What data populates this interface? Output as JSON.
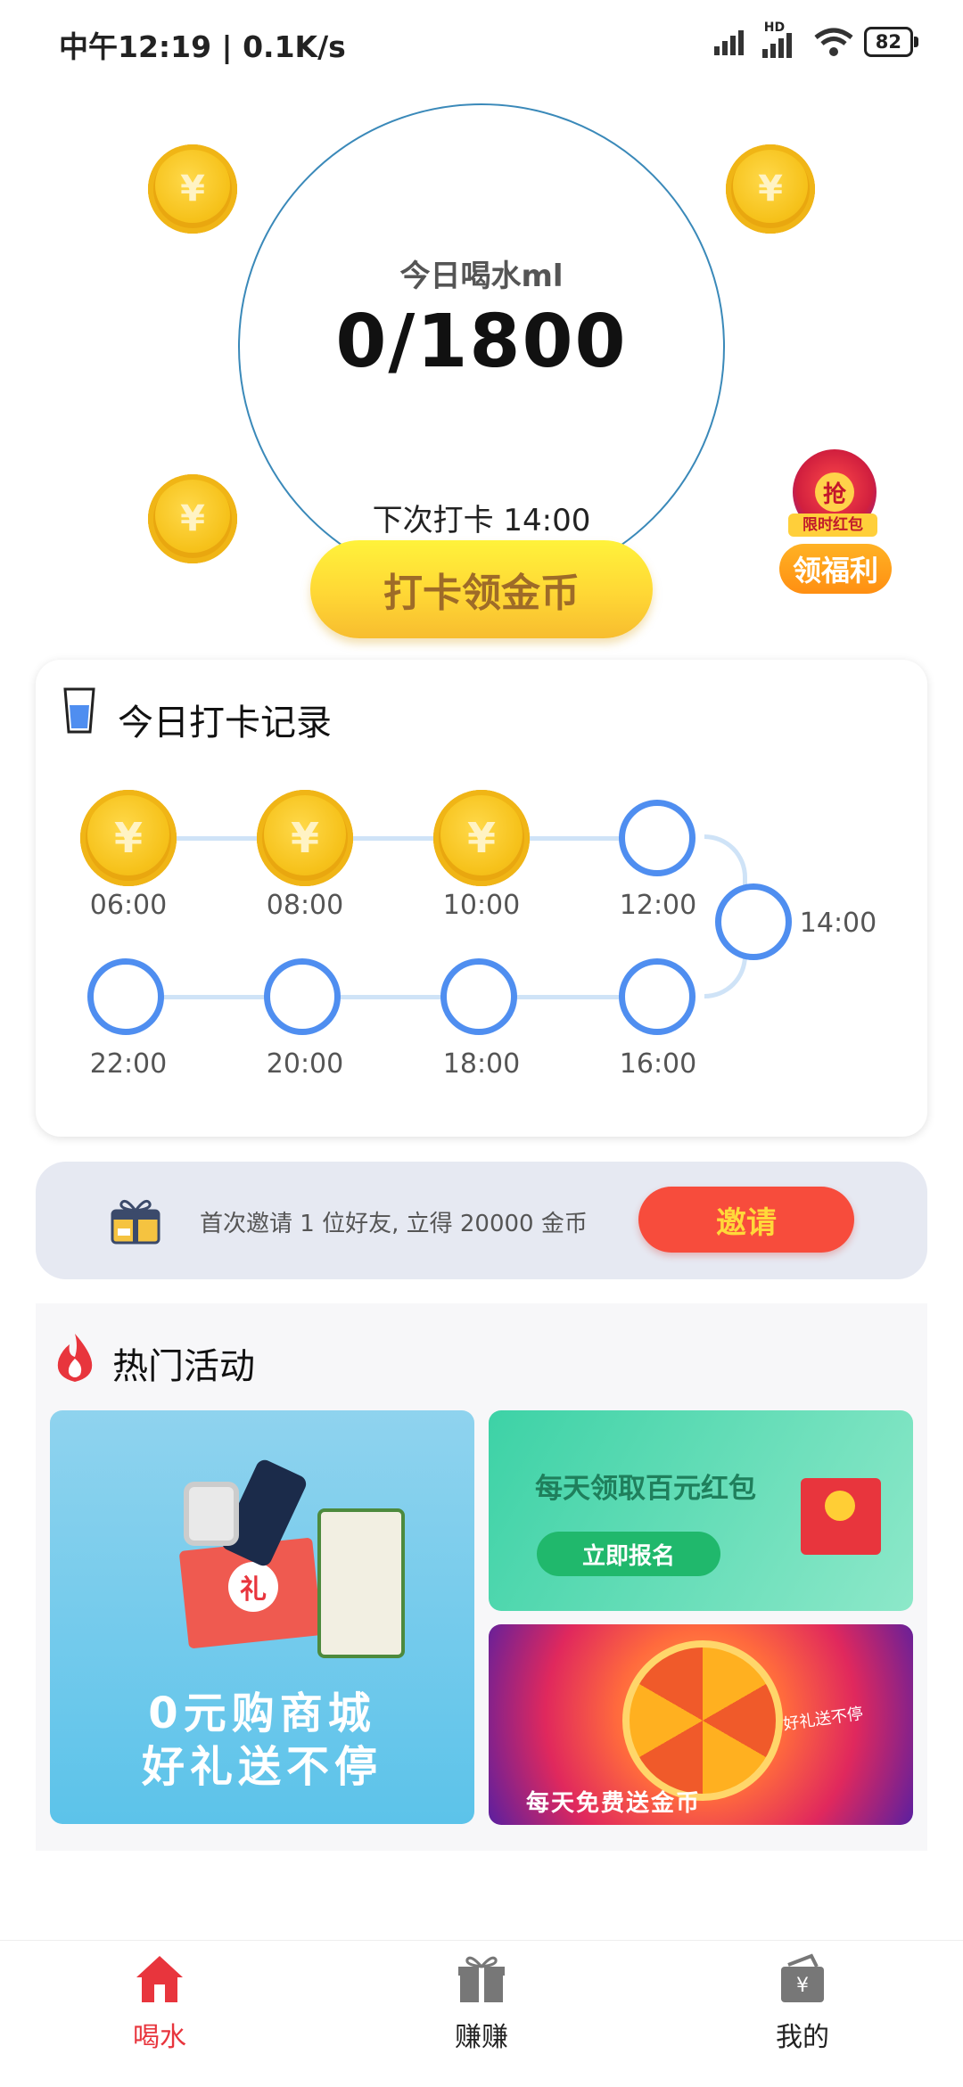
{
  "status_bar": {
    "time_speed": "中午12:19 | 0.1K/s",
    "network": "HD",
    "battery": "82"
  },
  "water": {
    "today_label": "今日喝水ml",
    "today_value": "0/1800",
    "next_checkin": "下次打卡  14:00",
    "checkin_button": "打卡领金币",
    "coin_symbol": "¥"
  },
  "welfare": {
    "icon_text": "抢",
    "tag": "限时红包",
    "button": "领福利"
  },
  "record": {
    "title": "今日打卡记录",
    "times": [
      "06:00",
      "08:00",
      "10:00",
      "12:00",
      "14:00",
      "16:00",
      "18:00",
      "20:00",
      "22:00"
    ]
  },
  "invite": {
    "text": "首次邀请 1 位好友, 立得 20000 金币",
    "button": "邀请"
  },
  "hot": {
    "title": "热门活动",
    "banner1_line1": "0元购商城",
    "banner1_line2": "好礼送不停",
    "banner1_badge": "礼",
    "banner2_title": "每天领取百元红包",
    "banner2_button": "立即报名",
    "banner3_text": "每天免费送金币",
    "banner3_side": "好礼送不停"
  },
  "nav": {
    "items": [
      {
        "label": "喝水",
        "icon": "home-icon",
        "active": true
      },
      {
        "label": "赚赚",
        "icon": "gift-icon",
        "active": false
      },
      {
        "label": "我的",
        "icon": "wallet-icon",
        "active": false
      }
    ],
    "active_color": "#e8353d"
  }
}
